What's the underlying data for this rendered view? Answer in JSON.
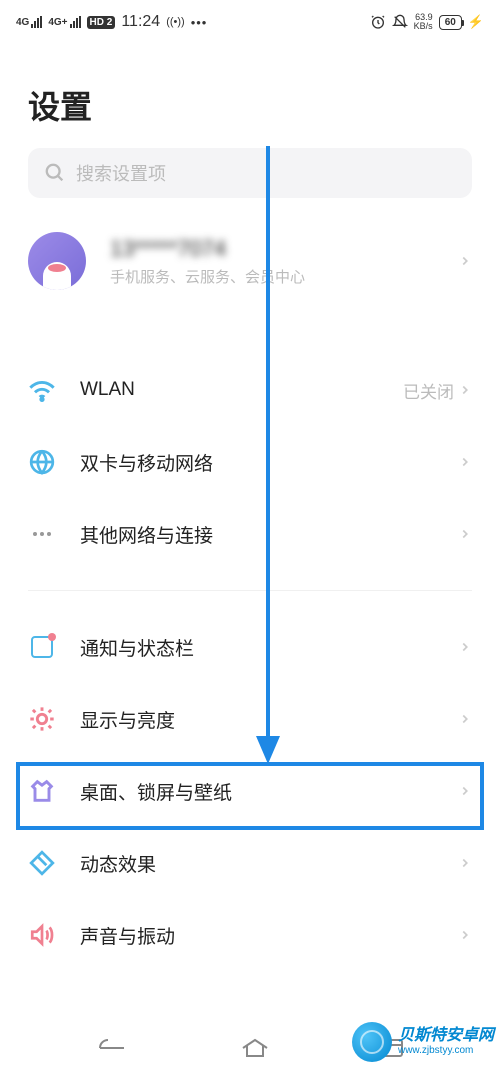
{
  "status": {
    "sim1": "4G",
    "sim2": "4G+",
    "hd": "HD 2",
    "time": "11:24",
    "hotspot": "((•))",
    "dots": "•••",
    "data_rate_top": "63.9",
    "data_rate_bottom": "KB/s",
    "battery": "60"
  },
  "page": {
    "title": "设置"
  },
  "search": {
    "placeholder": "搜索设置项"
  },
  "profile": {
    "name": "13*****7074",
    "subtitle": "手机服务、云服务、会员中心"
  },
  "sections": [
    {
      "items": [
        {
          "label": "WLAN",
          "value": "已关闭",
          "icon": "wifi",
          "color": "#4db6e8"
        },
        {
          "label": "双卡与移动网络",
          "icon": "globe",
          "color": "#4db6e8"
        },
        {
          "label": "其他网络与连接",
          "icon": "dots",
          "color": "#999"
        }
      ]
    },
    {
      "items": [
        {
          "label": "通知与状态栏",
          "icon": "notif",
          "color": "#4db6e8"
        },
        {
          "label": "显示与亮度",
          "icon": "sun",
          "color": "#f08090"
        },
        {
          "label": "桌面、锁屏与壁纸",
          "icon": "shirt",
          "color": "#9a8be8",
          "highlight": true
        },
        {
          "label": "动态效果",
          "icon": "diamond",
          "color": "#4db6e8"
        },
        {
          "label": "声音与振动",
          "icon": "speaker",
          "color": "#f08090"
        }
      ]
    }
  ],
  "watermark": {
    "title": "贝斯特安卓网",
    "url": "www.zjbstyy.com"
  }
}
